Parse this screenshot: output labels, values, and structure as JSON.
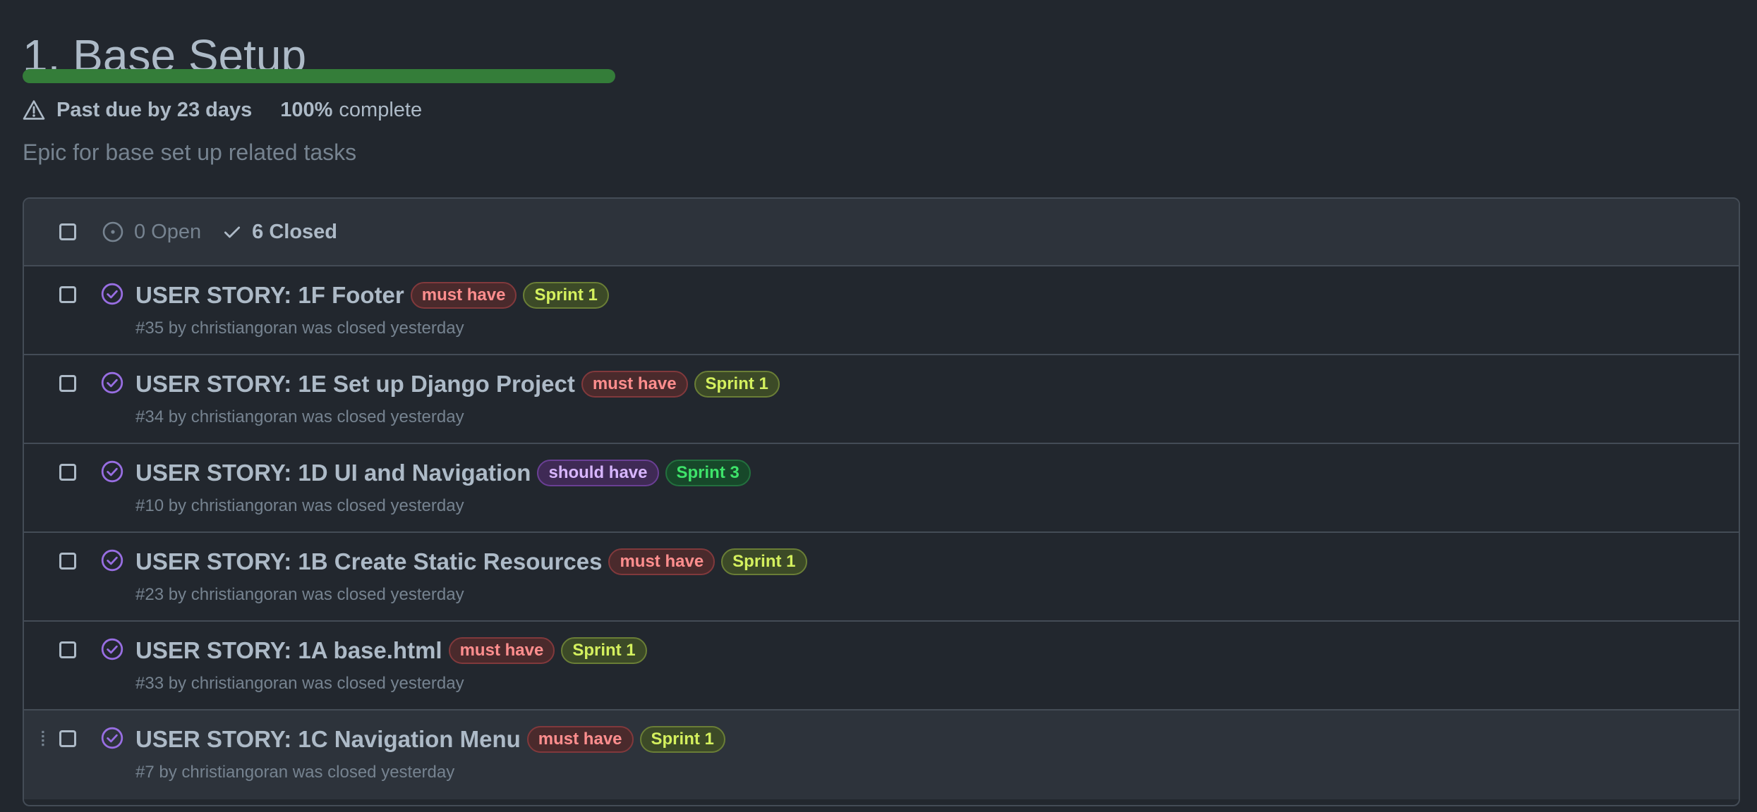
{
  "milestone": {
    "title": "1. Base Setup",
    "progress_percent": 100,
    "due_status": "Past due by 23 days",
    "percent_label": "100%",
    "complete_label": "complete",
    "description": "Epic for base set up related tasks"
  },
  "filters": {
    "open_label": "0 Open",
    "closed_label": "6 Closed"
  },
  "colors": {
    "progress": "#347d39",
    "closed_icon": "#986ee2"
  },
  "issues": [
    {
      "title": "USER STORY: 1F Footer",
      "labels": [
        {
          "text": "must have"
        },
        {
          "text": "Sprint 1"
        }
      ],
      "meta": "#35 by christiangoran was closed yesterday"
    },
    {
      "title": "USER STORY: 1E Set up Django Project",
      "labels": [
        {
          "text": "must have"
        },
        {
          "text": "Sprint 1"
        }
      ],
      "meta": "#34 by christiangoran was closed yesterday"
    },
    {
      "title": "USER STORY: 1D UI and Navigation",
      "labels": [
        {
          "text": "should have"
        },
        {
          "text": "Sprint 3"
        }
      ],
      "meta": "#10 by christiangoran was closed yesterday"
    },
    {
      "title": "USER STORY: 1B Create Static Resources",
      "labels": [
        {
          "text": "must have"
        },
        {
          "text": "Sprint 1"
        }
      ],
      "meta": "#23 by christiangoran was closed yesterday"
    },
    {
      "title": "USER STORY: 1A base.html",
      "labels": [
        {
          "text": "must have"
        },
        {
          "text": "Sprint 1"
        }
      ],
      "meta": "#33 by christiangoran was closed yesterday"
    },
    {
      "title": "USER STORY: 1C Navigation Menu",
      "labels": [
        {
          "text": "must have"
        },
        {
          "text": "Sprint 1"
        }
      ],
      "meta": "#7 by christiangoran was closed yesterday"
    }
  ]
}
